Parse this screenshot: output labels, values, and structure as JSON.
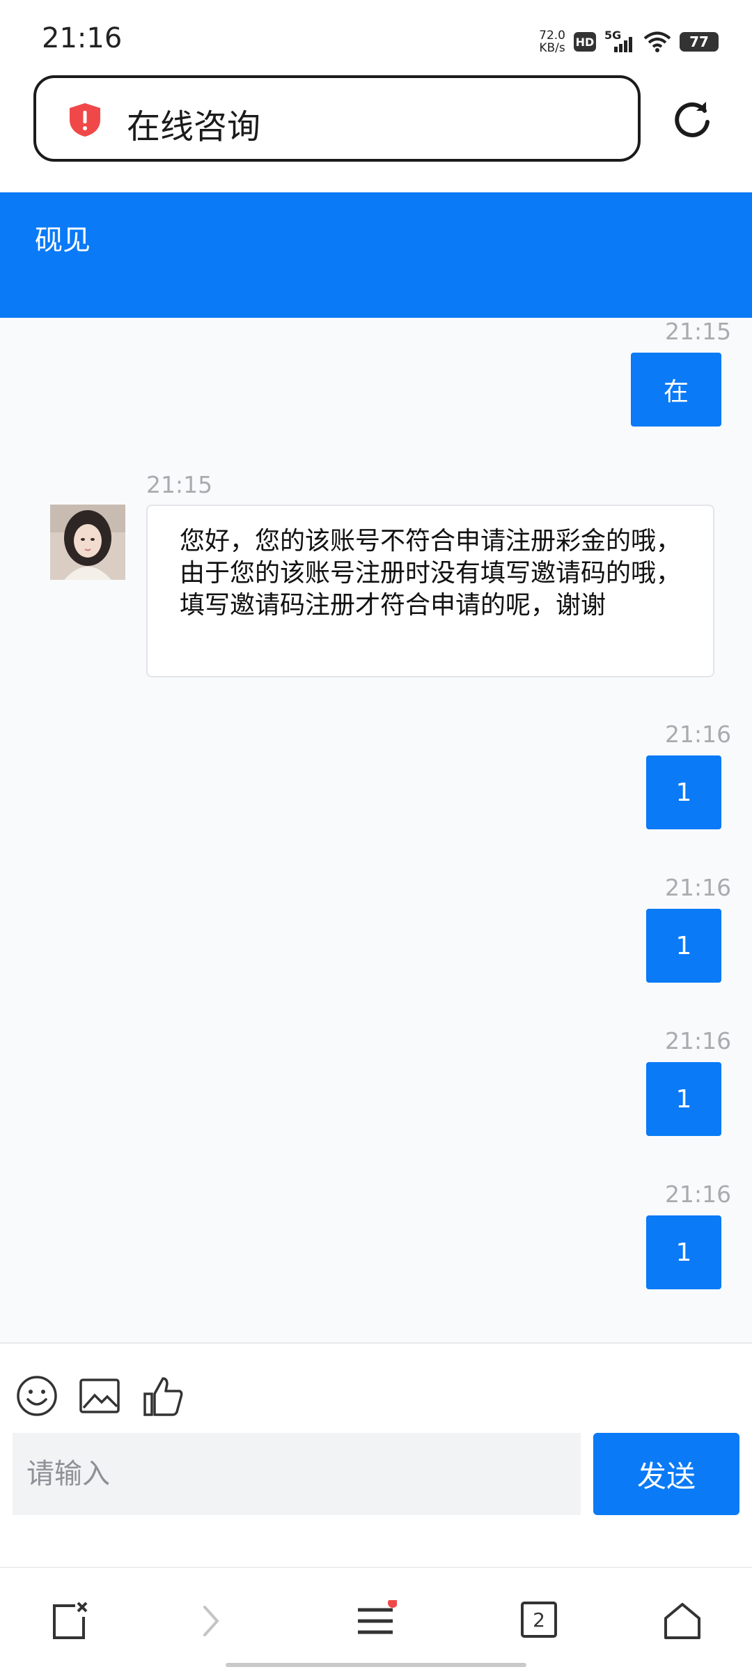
{
  "status_bar": {
    "time": "21:16",
    "net_speed_value": "72.0",
    "net_speed_unit": "KB/s",
    "hd_label": "HD",
    "network": "5G",
    "battery": "77"
  },
  "browser": {
    "address_text": "在线咨询",
    "tab_count": "2"
  },
  "chat": {
    "header_title": "砚见",
    "messages": [
      {
        "time": "21:15",
        "text": "在",
        "direction": "outgoing"
      },
      {
        "time": "21:15",
        "text": "您好，您的该账号不符合申请注册彩金的哦，由于您的该账号注册时没有填写邀请码的哦，填写邀请码注册才符合申请的呢，谢谢",
        "direction": "incoming"
      },
      {
        "time": "21:16",
        "text": "1",
        "direction": "outgoing"
      },
      {
        "time": "21:16",
        "text": "1",
        "direction": "outgoing"
      },
      {
        "time": "21:16",
        "text": "1",
        "direction": "outgoing"
      },
      {
        "time": "21:16",
        "text": "1",
        "direction": "outgoing"
      }
    ]
  },
  "composer": {
    "placeholder": "请输入",
    "value": "",
    "send_label": "发送",
    "tools": [
      "emoji-icon",
      "image-icon",
      "thumbs-up-icon"
    ]
  },
  "colors": {
    "accent": "#0a7af7",
    "alert": "#f04848"
  }
}
